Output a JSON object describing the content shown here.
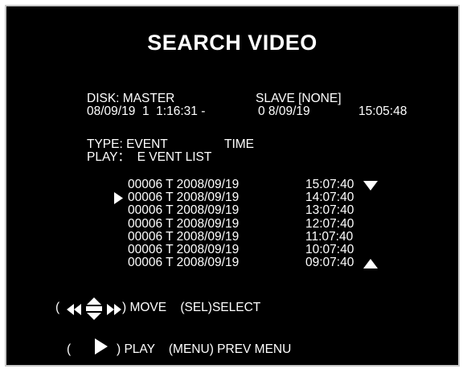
{
  "screen": {
    "title": "SEARCH VIDEO",
    "disk_line": "DISK: MASTER",
    "slave_line": "SLAVE [NONE]",
    "range_start": "08/09/19  1  1:16:31 -",
    "range_end": "0 8/09/19",
    "range_end_time": "15:05:48",
    "type_label": "TYPE: EVENT",
    "type_value": "TIME",
    "play_label": "PLAY：  E VENT LIST",
    "events": [
      {
        "record": "00006 T 2008/09/19",
        "time": "15:07:40",
        "selected": false
      },
      {
        "record": "00006 T 2008/09/19",
        "time": "14:07:40",
        "selected": true
      },
      {
        "record": "00006 T 2008/09/19",
        "time": "13:07:40",
        "selected": false
      },
      {
        "record": "00006 T 2008/09/19",
        "time": "12:07:40",
        "selected": false
      },
      {
        "record": "00006 T 2008/09/19",
        "time": "11:07:40",
        "selected": false
      },
      {
        "record": "00006 T 2008/09/19",
        "time": "10:07:40",
        "selected": false
      },
      {
        "record": "00006 T 2008/09/19",
        "time": "09:07:40",
        "selected": false
      }
    ],
    "move_open": "(",
    "move_label": ") MOVE    (SEL)SELECT",
    "play_open": "(",
    "play_hint": ") PLAY    (MENU) PREV MENU"
  },
  "colors": {
    "background": "#000000",
    "text": "#ffffff",
    "frame": "#c8c8c8"
  },
  "icons": {
    "scroll_down": "triangle-down-icon",
    "scroll_up": "triangle-up-icon",
    "selected_marker": "play-triangle-icon",
    "nav_keys": "arrow-keys-icon",
    "play_key": "play-triangle-icon"
  }
}
